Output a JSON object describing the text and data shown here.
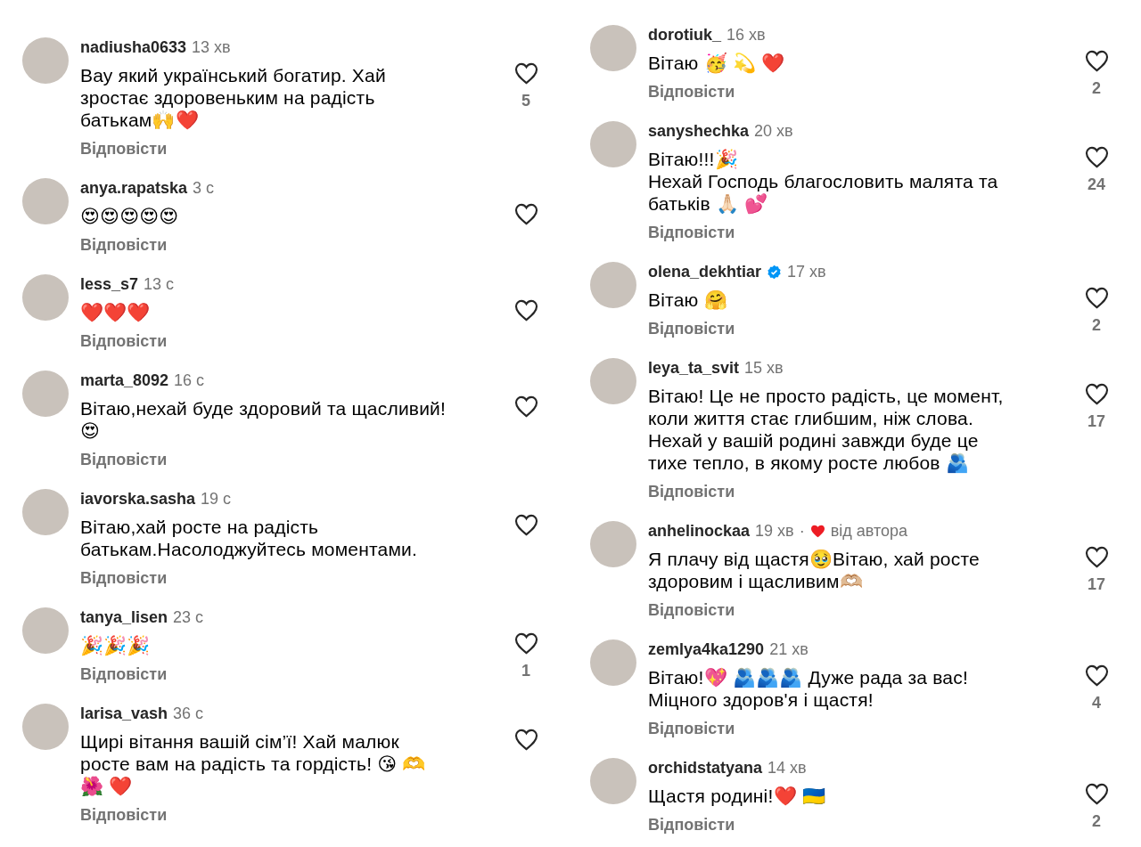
{
  "columns": [
    {
      "comments": [
        {
          "username": "nadiusha0633",
          "time": "13 хв",
          "verified": false,
          "liked_by_author": false,
          "text": "Вау  який  український  богатир.  Хай\nзростає  здоровеньким на радість\nбатькам🙌❤️",
          "reply": "Відповісти",
          "likes": "5"
        },
        {
          "username": "anya.rapatska",
          "time": "3 с",
          "verified": false,
          "liked_by_author": false,
          "text": "😍😍😍😍😍",
          "reply": "Відповісти"
        },
        {
          "username": "less_s7",
          "time": "13 с",
          "verified": false,
          "liked_by_author": false,
          "text": "❤️❤️❤️",
          "reply": "Відповісти"
        },
        {
          "username": "marta_8092",
          "time": "16 с",
          "verified": false,
          "liked_by_author": false,
          "text": "Вітаю,нехай буде здоровий та щасливий!\n😍",
          "reply": "Відповісти"
        },
        {
          "username": "iavorska.sasha",
          "time": "19 с",
          "verified": false,
          "liked_by_author": false,
          "text": "Вітаю,хай росте на радість\nбатькам.Насолоджуйтесь моментами.",
          "reply": "Відповісти"
        },
        {
          "username": "tanya_lisen",
          "time": "23 с",
          "verified": false,
          "liked_by_author": false,
          "text": "🎉🎉🎉",
          "reply": "Відповісти",
          "likes": "1"
        },
        {
          "username": "larisa_vash",
          "time": "36 с",
          "verified": false,
          "liked_by_author": false,
          "text": "Щирі вітання вашій сім’ї! Хай малюк\nросте вам на радість та гордість! 😘 🫶\n🌺 ❤️",
          "reply": "Відповісти"
        }
      ]
    },
    {
      "comments": [
        {
          "username": "dorotiuk_",
          "time": "16 хв",
          "verified": false,
          "liked_by_author": false,
          "text": "Вітаю 🥳 💫 ❤️",
          "reply": "Відповісти",
          "likes": "2"
        },
        {
          "username": "sanyshechka",
          "time": "20 хв",
          "verified": false,
          "liked_by_author": false,
          "text": "Вітаю!!!🎉\nНехай Господь благословить малята та\nбатьків 🙏🏻 💕",
          "reply": "Відповісти",
          "likes": "24"
        },
        {
          "username": "olena_dekhtiar",
          "time": "17 хв",
          "verified": true,
          "liked_by_author": false,
          "text": "Вітаю 🤗",
          "reply": "Відповісти",
          "likes": "2"
        },
        {
          "username": "leya_ta_svit",
          "time": "15 хв",
          "verified": false,
          "liked_by_author": false,
          "text": "Вітаю! Це не просто радість, це момент,\nколи життя стає глибшим, ніж слова.\nНехай у вашій родині завжди буде це\nтихе тепло, в якому росте любов 🫂",
          "reply": "Відповісти",
          "likes": "17"
        },
        {
          "username": "anhelinockaa",
          "time": "19 хв",
          "verified": false,
          "liked_by_author": true,
          "separator": "·",
          "author_label": "від автора",
          "text": "Я плачу від щастя🥹Вітаю, хай росте\nздоровим і щасливим🫶🏼",
          "reply": "Відповісти",
          "likes": "17"
        },
        {
          "username": "zemlya4ka1290",
          "time": "21 хв",
          "verified": false,
          "liked_by_author": false,
          "text": "Вітаю!💖 🫂🫂🫂 Дуже рада за вас!\nМіцного здоров'я і щастя!",
          "reply": "Відповісти",
          "likes": "4"
        },
        {
          "username": "orchidstatyana",
          "time": "14 хв",
          "verified": false,
          "liked_by_author": false,
          "text": "Щастя родині!❤️ 🇺🇦",
          "reply": "Відповісти",
          "likes": "2"
        }
      ]
    }
  ]
}
